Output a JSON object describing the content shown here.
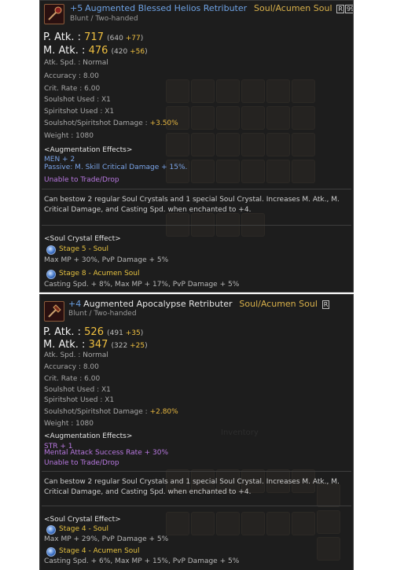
{
  "item1": {
    "enchant": "+5",
    "name": "Augmented Blessed Helios Retributer",
    "soul_tag": "Soul/Acumen Soul",
    "grade_1": "R",
    "grade_2": "99",
    "type": "Blunt / Two-handed",
    "p_atk_label": "P. Atk. : ",
    "p_atk": "717",
    "p_atk_base": "(640 ",
    "p_atk_bonus": "+77",
    "p_atk_close": ")",
    "m_atk_label": "M. Atk. : ",
    "m_atk": "476",
    "m_atk_base": "(420 ",
    "m_atk_bonus": "+56",
    "m_atk_close": ")",
    "atk_spd": "Atk. Spd. : Normal",
    "accuracy": "Accuracy : 8.00",
    "crit_rate": "Crit. Rate : 6.00",
    "soulshot_used": "Soulshot Used : X1",
    "spiritshot_used": "Spiritshot Used : X1",
    "shot_damage_label": "Soulshot/Spiritshot Damage : ",
    "shot_damage": "+3.50%",
    "weight": "Weight : 1080",
    "aug_header": "<Augmentation Effects>",
    "aug_stat": "MEN + 2",
    "aug_passive": "Passive: M. Skill Critical Damage + 15%.",
    "trade": "Unable to Trade/Drop",
    "description": "Can bestow 2 regular Soul Crystals and 1 special Soul Crystal. Increases M. Atk., M. Critical Damage, and Casting Spd. when enchanted to +4.",
    "crystal_header": "<Soul Crystal Effect>",
    "stage_a": "Stage 5 - Soul",
    "stage_a_effect": "Max MP + 30%, PvP Damage + 5%",
    "stage_b": "Stage 8 - Acumen Soul",
    "stage_b_effect": "Casting Spd. + 8%, Max MP + 17%, PvP Damage + 5%"
  },
  "item2": {
    "enchant": "+4",
    "name": "Augmented Apocalypse Retributer",
    "soul_tag": "Soul/Acumen Soul",
    "grade_1": "R",
    "type": "Blunt / Two-handed",
    "p_atk_label": "P. Atk. : ",
    "p_atk": "526",
    "p_atk_base": "(491 ",
    "p_atk_bonus": "+35",
    "p_atk_close": ")",
    "m_atk_label": "M. Atk. : ",
    "m_atk": "347",
    "m_atk_base": "(322 ",
    "m_atk_bonus": "+25",
    "m_atk_close": ")",
    "atk_spd": "Atk. Spd. : Normal",
    "accuracy": "Accuracy : 8.00",
    "crit_rate": "Crit. Rate : 6.00",
    "soulshot_used": "Soulshot Used : X1",
    "spiritshot_used": "Spiritshot Used : X1",
    "shot_damage_label": "Soulshot/Spiritshot Damage : ",
    "shot_damage": "+2.80%",
    "weight": "Weight : 1080",
    "aug_header": "<Augmentation Effects>",
    "aug_stat": "STR + 1",
    "aug_passive": "Mental Attack Success Rate + 30%",
    "trade": "Unable to Trade/Drop",
    "description": "Can bestow 2 regular Soul Crystals and 1 special Soul Crystal. Increases M. Atk., M. Critical Damage, and Casting Spd. when enchanted to +4.",
    "crystal_header": "<Soul Crystal Effect>",
    "stage_a": "Stage 4 - Soul",
    "stage_a_effect": "Max MP + 29%, PvP Damage + 5%",
    "stage_b": "Stage 4 - Acumen Soul",
    "stage_b_effect": "Casting Spd. + 6%, Max MP + 15%, PvP Damage + 5%"
  },
  "icons": {
    "weapon_icon_1": "blunt-weapon-icon",
    "weapon_icon_2": "blunt-weapon-icon",
    "crystal_icon": "soul-crystal-icon"
  },
  "colors": {
    "panel_bg": "#0c0c0c",
    "enchant_blue": "#6a9ee0",
    "soul_gold": "#d8b04a",
    "stat_gold": "#f0c040",
    "augment_blue": "#7aa4e8",
    "augment_purple": "#b878e0"
  }
}
